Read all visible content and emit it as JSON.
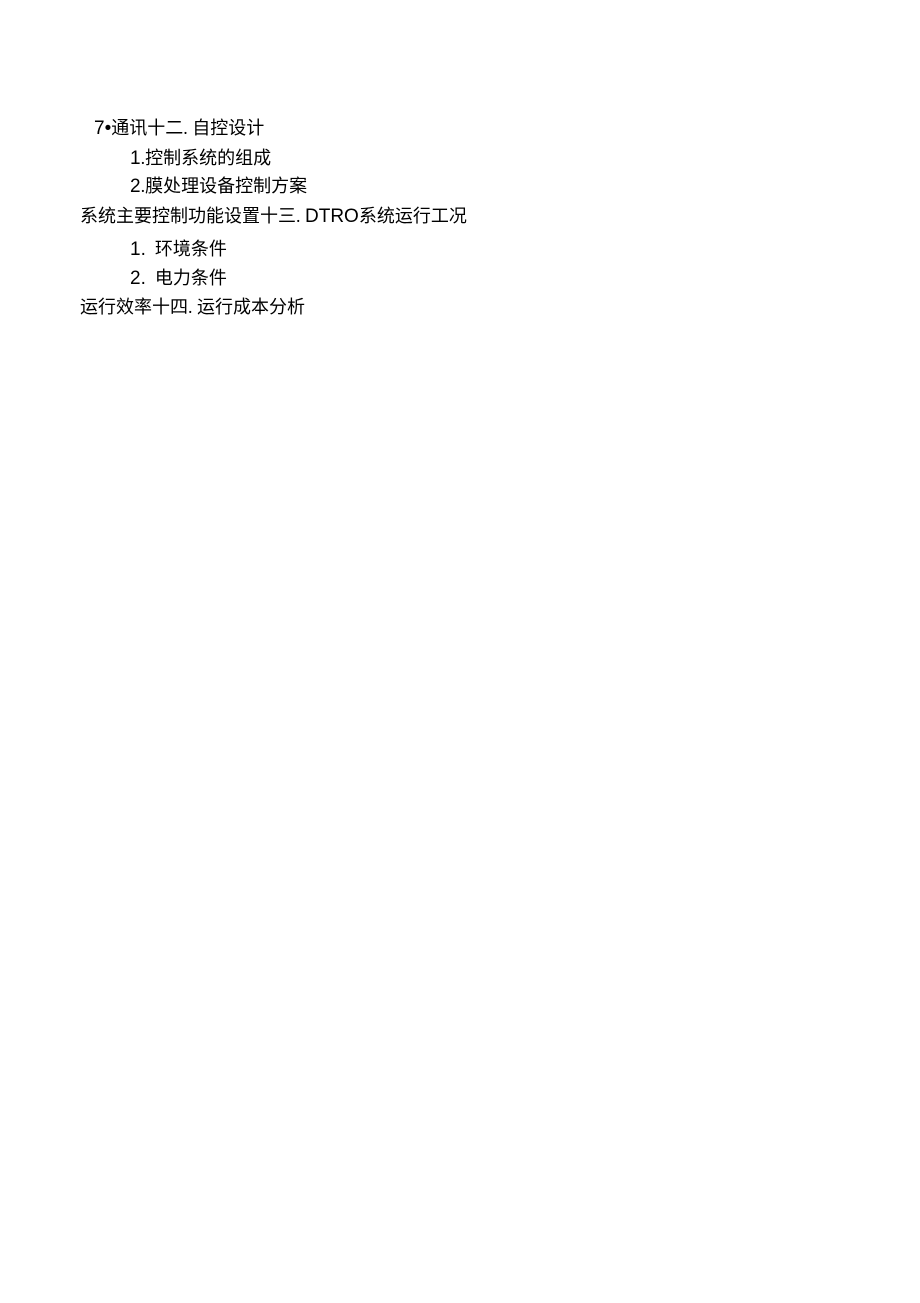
{
  "section7": {
    "prefix_num": "7",
    "prefix_bullet": "•",
    "heading_text": "通讯十二. 自控设计",
    "items": [
      {
        "num": "1",
        "dot": " . ",
        "text": "控制系统的组成"
      },
      {
        "num": "2",
        "dot": " . ",
        "text": "膜处理设备控制方案"
      }
    ],
    "trailing_line_prefix": "系统主要控制功能设置十三. ",
    "trailing_dtro": "DTRO",
    "trailing_line_suffix": "系统运行工况"
  },
  "section_next": {
    "items": [
      {
        "num": "1.",
        "text": "环境条件"
      },
      {
        "num": "2.",
        "text": "电力条件"
      }
    ],
    "trailing_line": "运行效率十四. 运行成本分析"
  }
}
